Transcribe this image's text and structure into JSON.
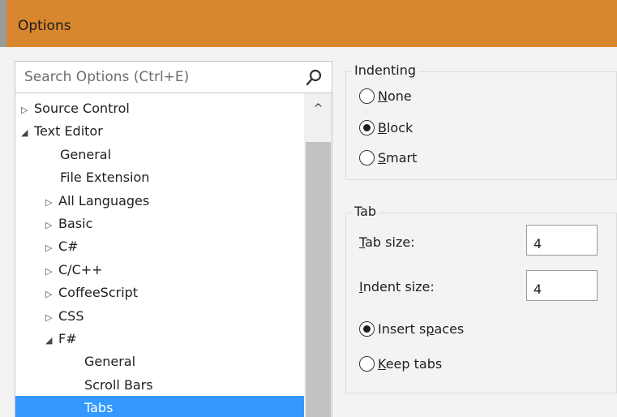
{
  "window": {
    "title": "Options"
  },
  "search": {
    "placeholder": "Search Options (Ctrl+E)"
  },
  "icons": {
    "search": "search-icon",
    "expand_collapsed": "triangle-right-outline",
    "expand_open": "triangle-down-filled",
    "scroll_up": "chevron-up"
  },
  "tree": {
    "items": [
      {
        "label": "Source Control",
        "arrow": "▷",
        "indent": 0,
        "selected": false
      },
      {
        "label": "Text Editor",
        "arrow": "◢",
        "indent": 0,
        "selected": false
      },
      {
        "label": "General",
        "arrow": "",
        "indent": 1,
        "selected": false
      },
      {
        "label": "File Extension",
        "arrow": "",
        "indent": 1,
        "selected": false
      },
      {
        "label": "All Languages",
        "arrow": "▷",
        "indent": 1,
        "selected": false
      },
      {
        "label": "Basic",
        "arrow": "▷",
        "indent": 1,
        "selected": false
      },
      {
        "label": "C#",
        "arrow": "▷",
        "indent": 1,
        "selected": false
      },
      {
        "label": "C/C++",
        "arrow": "▷",
        "indent": 1,
        "selected": false
      },
      {
        "label": "CoffeeScript",
        "arrow": "▷",
        "indent": 1,
        "selected": false
      },
      {
        "label": "CSS",
        "arrow": "▷",
        "indent": 1,
        "selected": false
      },
      {
        "label": "F#",
        "arrow": "◢",
        "indent": 1,
        "selected": false
      },
      {
        "label": "General",
        "arrow": "",
        "indent": 2,
        "selected": false
      },
      {
        "label": "Scroll Bars",
        "arrow": "",
        "indent": 2,
        "selected": false
      },
      {
        "label": "Tabs",
        "arrow": "",
        "indent": 2,
        "selected": true
      }
    ]
  },
  "indenting": {
    "legend": "Indenting",
    "options": [
      {
        "mnemonic": "N",
        "rest": "one",
        "checked": false
      },
      {
        "mnemonic": "B",
        "rest": "lock",
        "checked": true
      },
      {
        "mnemonic": "S",
        "rest": "mart",
        "checked": false
      }
    ]
  },
  "tab": {
    "legend": "Tab",
    "tab_size_mnemonic": "T",
    "tab_size_rest": "ab size:",
    "tab_size_value": "4",
    "indent_size_mnemonic": "I",
    "indent_size_rest": "ndent size:",
    "indent_size_value": "4",
    "insert_spaces_pre": "Insert s",
    "insert_spaces_mnemonic": "p",
    "insert_spaces_post": "aces",
    "insert_spaces_checked": true,
    "keep_tabs_mnemonic": "K",
    "keep_tabs_rest": "eep tabs",
    "keep_tabs_checked": false
  },
  "colors": {
    "titlebar": "#d8872e",
    "selection": "#3399ff"
  }
}
